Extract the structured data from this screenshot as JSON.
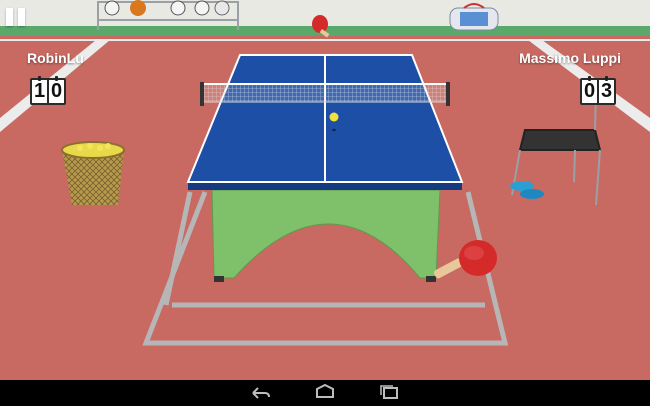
{
  "game": {
    "player_left": {
      "name": "RobinLu",
      "score_digits": [
        "1",
        "0"
      ]
    },
    "player_right": {
      "name": "Massimo Luppi",
      "score_digits": [
        "0",
        "3"
      ]
    }
  },
  "icons": {
    "pause": "pause-icon",
    "back": "back-icon",
    "home": "home-icon",
    "recent_apps": "recent-apps-icon"
  },
  "colors": {
    "floor": "#c86a62",
    "table_top": "#1e4fa6",
    "table_base": "#7fc06a",
    "paddle": "#d42a2a",
    "ball": "#f2e23a"
  }
}
